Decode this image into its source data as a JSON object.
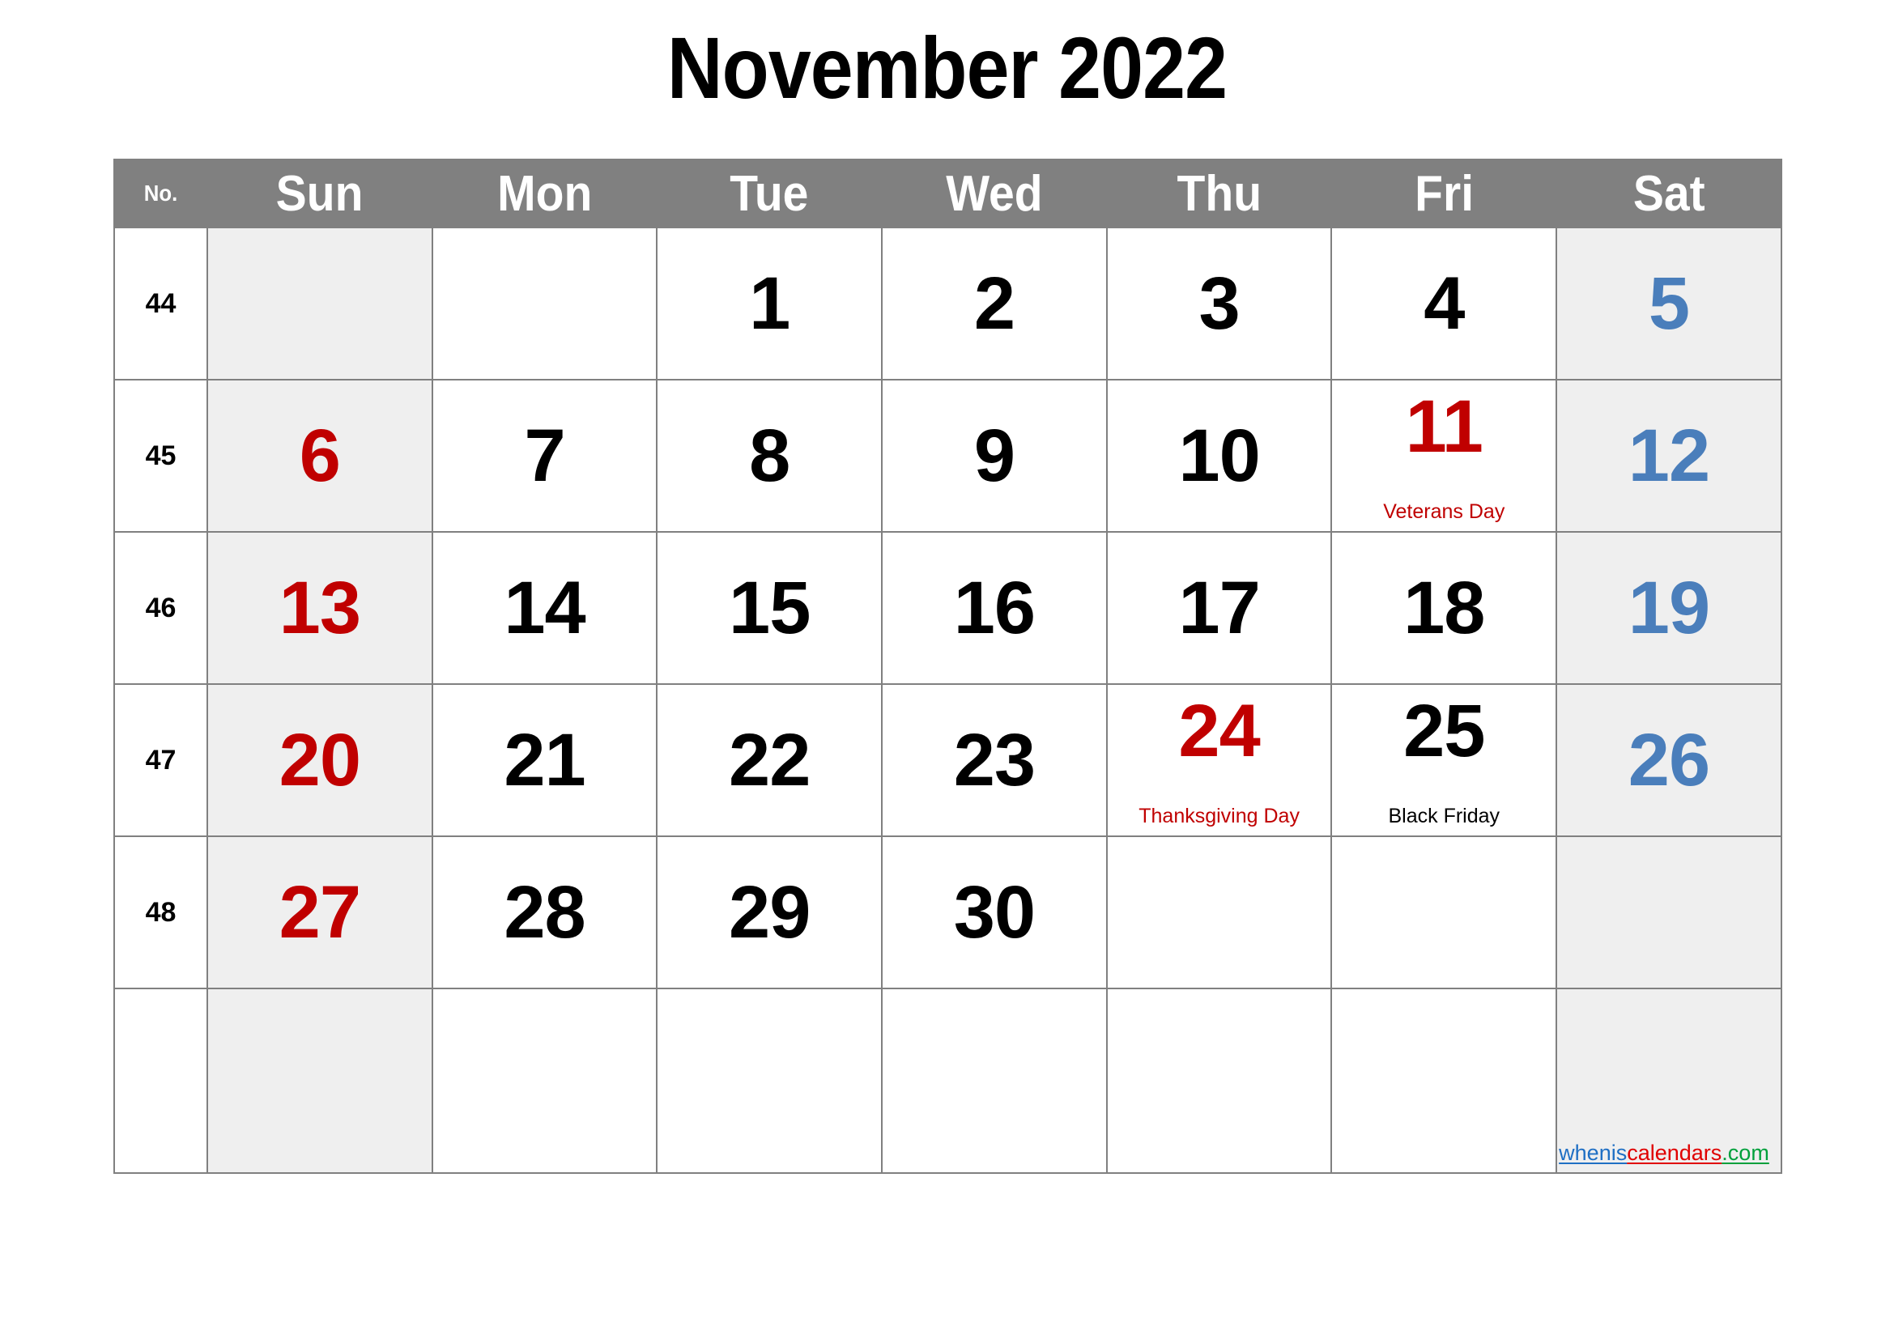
{
  "title": "November 2022",
  "header": {
    "week_no_label": "No.",
    "days": [
      "Sun",
      "Mon",
      "Tue",
      "Wed",
      "Thu",
      "Fri",
      "Sat"
    ]
  },
  "colors": {
    "header_bg": "#808080",
    "weekend_bg": "#efefef",
    "grid_line": "#808080",
    "sunday_text": "#c00000",
    "saturday_text": "#4a7ebb",
    "weekday_text": "#000000",
    "holiday_text": "#c00000"
  },
  "weeks": [
    {
      "no": "44",
      "days": [
        {
          "num": "",
          "kind": "sun",
          "note": "",
          "note_color": ""
        },
        {
          "num": "",
          "kind": "weekday",
          "note": "",
          "note_color": ""
        },
        {
          "num": "1",
          "kind": "weekday",
          "note": "",
          "note_color": ""
        },
        {
          "num": "2",
          "kind": "weekday",
          "note": "",
          "note_color": ""
        },
        {
          "num": "3",
          "kind": "weekday",
          "note": "",
          "note_color": ""
        },
        {
          "num": "4",
          "kind": "weekday",
          "note": "",
          "note_color": ""
        },
        {
          "num": "5",
          "kind": "sat",
          "note": "",
          "note_color": ""
        }
      ]
    },
    {
      "no": "45",
      "days": [
        {
          "num": "6",
          "kind": "sun",
          "note": "",
          "note_color": ""
        },
        {
          "num": "7",
          "kind": "weekday",
          "note": "",
          "note_color": ""
        },
        {
          "num": "8",
          "kind": "weekday",
          "note": "",
          "note_color": ""
        },
        {
          "num": "9",
          "kind": "weekday",
          "note": "",
          "note_color": ""
        },
        {
          "num": "10",
          "kind": "weekday",
          "note": "",
          "note_color": ""
        },
        {
          "num": "11",
          "kind": "holiday",
          "note": "Veterans Day",
          "note_color": "red"
        },
        {
          "num": "12",
          "kind": "sat",
          "note": "",
          "note_color": ""
        }
      ]
    },
    {
      "no": "46",
      "days": [
        {
          "num": "13",
          "kind": "sun",
          "note": "",
          "note_color": ""
        },
        {
          "num": "14",
          "kind": "weekday",
          "note": "",
          "note_color": ""
        },
        {
          "num": "15",
          "kind": "weekday",
          "note": "",
          "note_color": ""
        },
        {
          "num": "16",
          "kind": "weekday",
          "note": "",
          "note_color": ""
        },
        {
          "num": "17",
          "kind": "weekday",
          "note": "",
          "note_color": ""
        },
        {
          "num": "18",
          "kind": "weekday",
          "note": "",
          "note_color": ""
        },
        {
          "num": "19",
          "kind": "sat",
          "note": "",
          "note_color": ""
        }
      ]
    },
    {
      "no": "47",
      "days": [
        {
          "num": "20",
          "kind": "sun",
          "note": "",
          "note_color": ""
        },
        {
          "num": "21",
          "kind": "weekday",
          "note": "",
          "note_color": ""
        },
        {
          "num": "22",
          "kind": "weekday",
          "note": "",
          "note_color": ""
        },
        {
          "num": "23",
          "kind": "weekday",
          "note": "",
          "note_color": ""
        },
        {
          "num": "24",
          "kind": "holiday",
          "note": "Thanksgiving Day",
          "note_color": "red"
        },
        {
          "num": "25",
          "kind": "weekday",
          "note": "Black Friday",
          "note_color": "black"
        },
        {
          "num": "26",
          "kind": "sat",
          "note": "",
          "note_color": ""
        }
      ]
    },
    {
      "no": "48",
      "days": [
        {
          "num": "27",
          "kind": "sun",
          "note": "",
          "note_color": ""
        },
        {
          "num": "28",
          "kind": "weekday",
          "note": "",
          "note_color": ""
        },
        {
          "num": "29",
          "kind": "weekday",
          "note": "",
          "note_color": ""
        },
        {
          "num": "30",
          "kind": "weekday",
          "note": "",
          "note_color": ""
        },
        {
          "num": "",
          "kind": "weekday",
          "note": "",
          "note_color": ""
        },
        {
          "num": "",
          "kind": "weekday",
          "note": "",
          "note_color": ""
        },
        {
          "num": "",
          "kind": "sat",
          "note": "",
          "note_color": ""
        }
      ]
    },
    {
      "no": "",
      "days": [
        {
          "num": "",
          "kind": "sun",
          "note": "",
          "note_color": ""
        },
        {
          "num": "",
          "kind": "weekday",
          "note": "",
          "note_color": ""
        },
        {
          "num": "",
          "kind": "weekday",
          "note": "",
          "note_color": ""
        },
        {
          "num": "",
          "kind": "weekday",
          "note": "",
          "note_color": ""
        },
        {
          "num": "",
          "kind": "weekday",
          "note": "",
          "note_color": ""
        },
        {
          "num": "",
          "kind": "weekday",
          "note": "",
          "note_color": ""
        },
        {
          "num": "",
          "kind": "sat",
          "note": "",
          "note_color": ""
        }
      ]
    }
  ],
  "watermark": {
    "part1": "whenis",
    "part2": "calendars",
    "part3": ".com"
  }
}
